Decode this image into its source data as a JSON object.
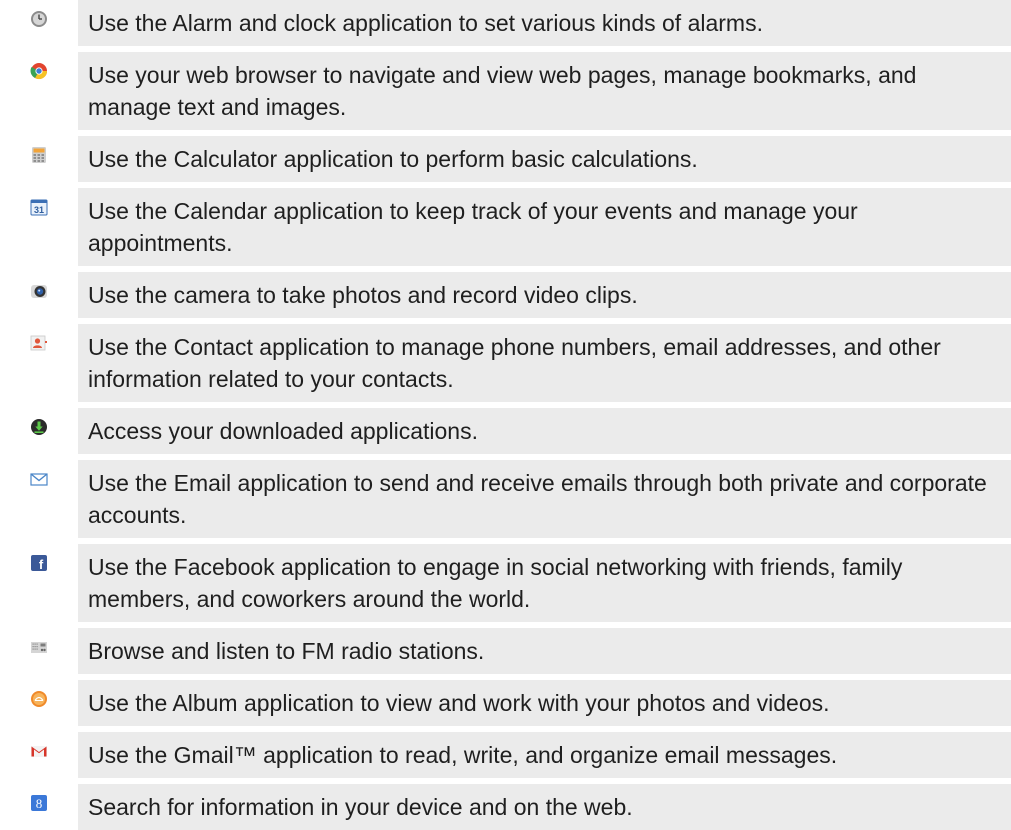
{
  "rows": [
    {
      "icon": "alarm-clock-icon",
      "text": "Use the Alarm and clock application to set various kinds of alarms."
    },
    {
      "icon": "web-browser-icon",
      "text": "Use your web browser to navigate and view web pages, manage bookmarks, and manage text and images."
    },
    {
      "icon": "calculator-icon",
      "text": "Use the Calculator application to perform basic calculations."
    },
    {
      "icon": "calendar-icon",
      "text": "Use the Calendar application to keep track of your events and manage your appointments.",
      "icon_label": "31"
    },
    {
      "icon": "camera-icon",
      "text": "Use the camera to take photos and record video clips."
    },
    {
      "icon": "contacts-icon",
      "text": "Use the Contact application to manage phone numbers, email addresses, and other information related to your contacts."
    },
    {
      "icon": "download-icon",
      "text": "Access your downloaded applications."
    },
    {
      "icon": "email-icon",
      "text": "Use the Email application to send and receive emails through both private and corporate accounts."
    },
    {
      "icon": "facebook-icon",
      "text": "Use the Facebook application to engage in social networking with friends, family members, and coworkers around the world.",
      "icon_label": "f"
    },
    {
      "icon": "fm-radio-icon",
      "text": "Browse and listen to FM radio stations."
    },
    {
      "icon": "album-icon",
      "text": "Use the Album application to view and work with your photos and videos."
    },
    {
      "icon": "gmail-icon",
      "text": "Use the Gmail™ application to read, write, and organize email messages."
    },
    {
      "icon": "google-search-icon",
      "text": "Search for information in your device and on the web.",
      "icon_label": "8"
    }
  ]
}
